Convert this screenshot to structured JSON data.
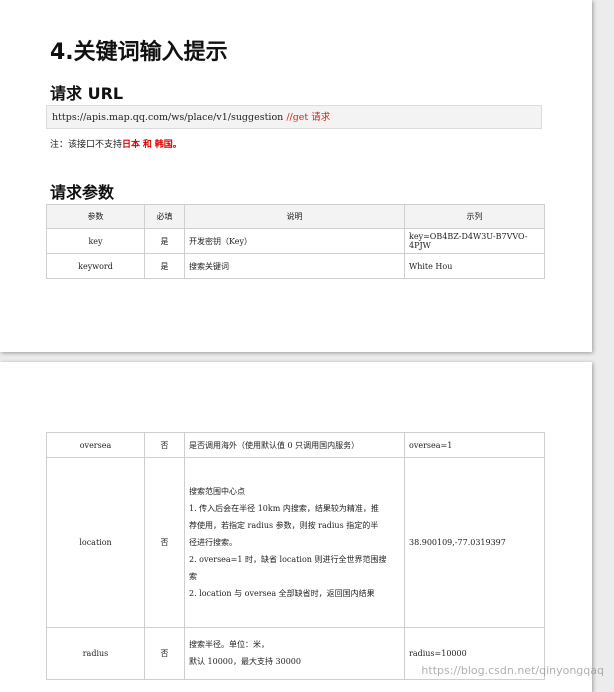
{
  "heading": "4.关键词输入提示",
  "request_url": {
    "title": "请求 URL",
    "url": "https://apis.map.qq.com/ws/place/v1/suggestion ",
    "comment": "//get 请求"
  },
  "note": {
    "prefix": "注：该接口不支持",
    "c1": "日本",
    "and": "和",
    "c2": "韩国。"
  },
  "params_title": "请求参数",
  "table_headers": [
    "参数",
    "必填",
    "说明",
    "示列"
  ],
  "rows_page1": [
    {
      "param": "key",
      "required": "是",
      "desc": "开发密钥（Key）",
      "example": "key=OB4BZ-D4W3U-B7VVO-4PJW"
    },
    {
      "param": "keyword",
      "required": "是",
      "desc": "搜索关键词",
      "example": "White Hou"
    }
  ],
  "rows_page2": [
    {
      "param": "oversea",
      "required": "否",
      "desc": [
        "是否调用海外（使用默认值 0 只调用国内服务）"
      ],
      "example": "oversea=1"
    },
    {
      "param": "location",
      "required": "否",
      "desc": [
        "搜索范围中心点",
        "1. 传入后会在半径 10km 内搜索，结果较为精准，推",
        "荐使用，若指定 radius 参数，则按 radius 指定的半",
        "径进行搜索。",
        "2. oversea=1 时，缺省 location 则进行全世界范围搜",
        "索",
        "2. location 与 oversea 全部缺省时，返回国内结果"
      ],
      "example": "38.900109,-77.0319397"
    },
    {
      "param": "radius",
      "required": "否",
      "desc": [
        "搜索半径。单位：米，",
        "默认 10000，最大支持 30000"
      ],
      "example": "radius=10000"
    }
  ],
  "watermark": "https://blog.csdn.net/qinyongqaq"
}
